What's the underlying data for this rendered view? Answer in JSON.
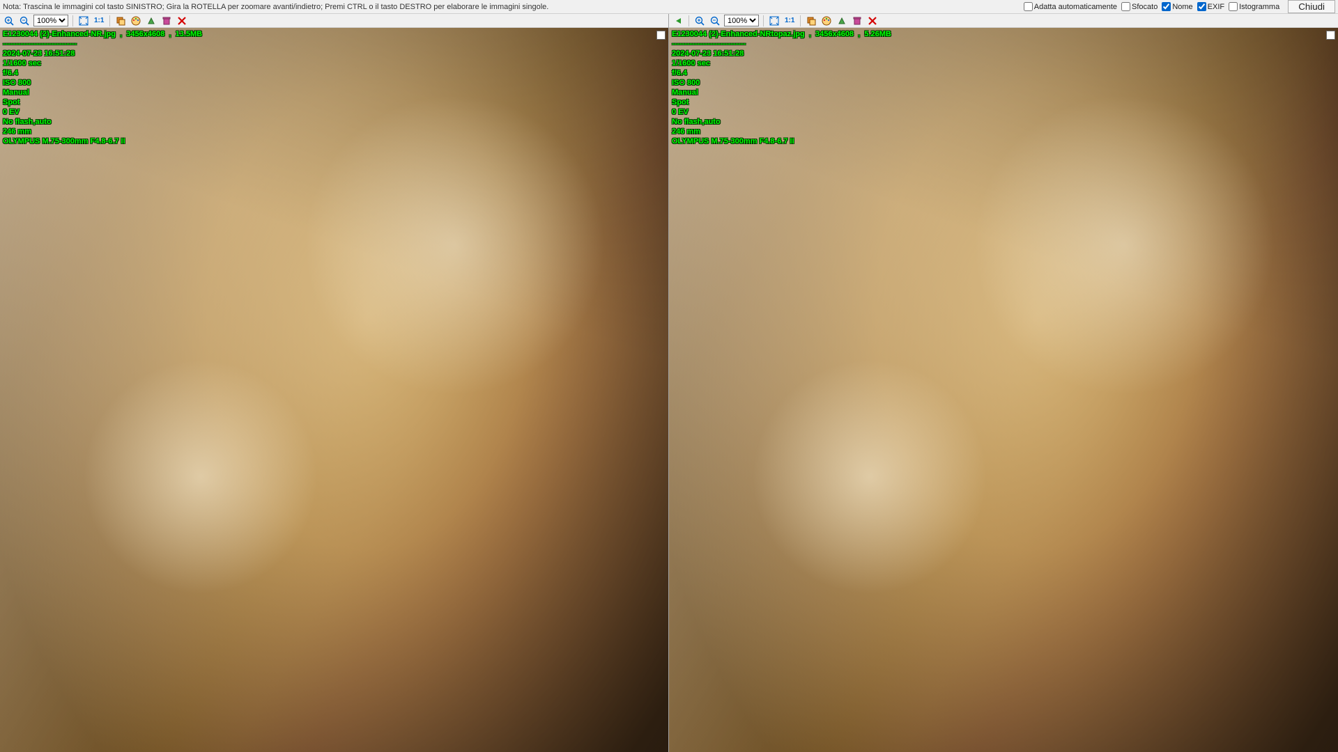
{
  "topbar": {
    "note": "Nota: Trascina le immagini col tasto SINISTRO; Gira la ROTELLA per zoomare avanti/indietro; Premi CTRL o il tasto DESTRO per elaborare le immagini singole.",
    "checkboxes": {
      "adatta": {
        "label": "Adatta automaticamente",
        "checked": false
      },
      "sfocato": {
        "label": "Sfocato",
        "checked": false
      },
      "nome": {
        "label": "Nome",
        "checked": true
      },
      "exif": {
        "label": "EXIF",
        "checked": true
      },
      "istogramma": {
        "label": "Istogramma",
        "checked": false
      }
    },
    "close": "Chiudi"
  },
  "panes": [
    {
      "zoom": "100%",
      "onetoone": "1:1",
      "title_line": "E1230044 (2)-Enhanced-NR.jpg  ,  3456x4608  ,  13.5MB",
      "dashes": "-----------------------------",
      "exif": [
        "2024-07-23 16:51:28",
        "1/1600 sec",
        "f/6.4",
        "ISO 800",
        "Manual",
        "Spot",
        "0 EV",
        "No flash,auto",
        "246 mm",
        "OLYMPUS M.75-300mm F4.8-6.7 II"
      ],
      "back_arrow": true
    },
    {
      "zoom": "100%",
      "onetoone": "1:1",
      "title_line": "E1230044 (2)-Enhanced-NRtopaz.jpg  ,  3456x4608  ,  5.26MB",
      "dashes": "-----------------------------",
      "exif": [
        "2024-07-23 16:51:28",
        "1/1600 sec",
        "f/6.4",
        "ISO 800",
        "Manual",
        "Spot",
        "0 EV",
        "No flash,auto",
        "246 mm",
        "OLYMPUS M.75-300mm F4.8-6.7 II"
      ],
      "back_arrow": false
    }
  ]
}
